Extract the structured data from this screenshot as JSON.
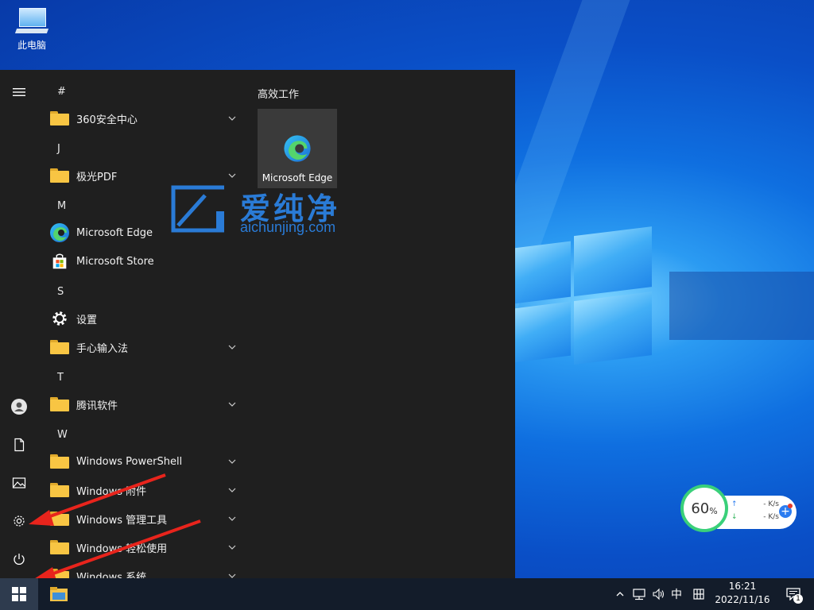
{
  "desktop": {
    "icon_label": "此电脑"
  },
  "start_menu": {
    "rail": {
      "items": [
        {
          "name": "hamburger-menu-icon"
        },
        {
          "name": "user-avatar-icon"
        },
        {
          "name": "documents-icon"
        },
        {
          "name": "pictures-icon"
        },
        {
          "name": "settings-gear-icon"
        },
        {
          "name": "power-icon"
        }
      ]
    },
    "app_list": {
      "headers": [
        "#",
        "J",
        "M",
        "S",
        "T",
        "W"
      ],
      "apps": [
        {
          "label": "360安全中心",
          "icon": "folder-icon",
          "expandable": true
        },
        {
          "label": "极光PDF",
          "icon": "folder-icon",
          "expandable": true
        },
        {
          "label": "Microsoft Edge",
          "icon": "edge-icon",
          "expandable": false
        },
        {
          "label": "Microsoft Store",
          "icon": "store-icon",
          "expandable": false
        },
        {
          "label": "设置",
          "icon": "gear-icon",
          "expandable": false
        },
        {
          "label": "手心输入法",
          "icon": "folder-icon",
          "expandable": true
        },
        {
          "label": "腾讯软件",
          "icon": "folder-icon",
          "expandable": true
        },
        {
          "label": "Windows PowerShell",
          "icon": "folder-icon",
          "expandable": true
        },
        {
          "label": "Windows 附件",
          "icon": "folder-icon",
          "expandable": true
        },
        {
          "label": "Windows 管理工具",
          "icon": "folder-icon",
          "expandable": true
        },
        {
          "label": "Windows 轻松使用",
          "icon": "folder-icon",
          "expandable": true
        },
        {
          "label": "Windows 系统",
          "icon": "folder-icon",
          "expandable": true
        }
      ]
    },
    "tiles": {
      "group_title": "高效工作",
      "edge_tile_label": "Microsoft Edge"
    }
  },
  "watermark": {
    "chinese": "爱纯净",
    "domain": "aichunjing.com"
  },
  "net_widget": {
    "percent": "60",
    "percent_unit": "%",
    "upload": "- K/s",
    "download": "- K/s",
    "plus_label": "+"
  },
  "taskbar": {
    "ime_label": "中",
    "time": "16:21",
    "date": "2022/11/16",
    "notification_count": "1"
  },
  "colors": {
    "start_menu_bg": "#1f1f1f",
    "taskbar_bg": "#131c2a",
    "arrow": "#e8241c",
    "watermark": "#2a7bd6",
    "folder": "#f8c543"
  }
}
